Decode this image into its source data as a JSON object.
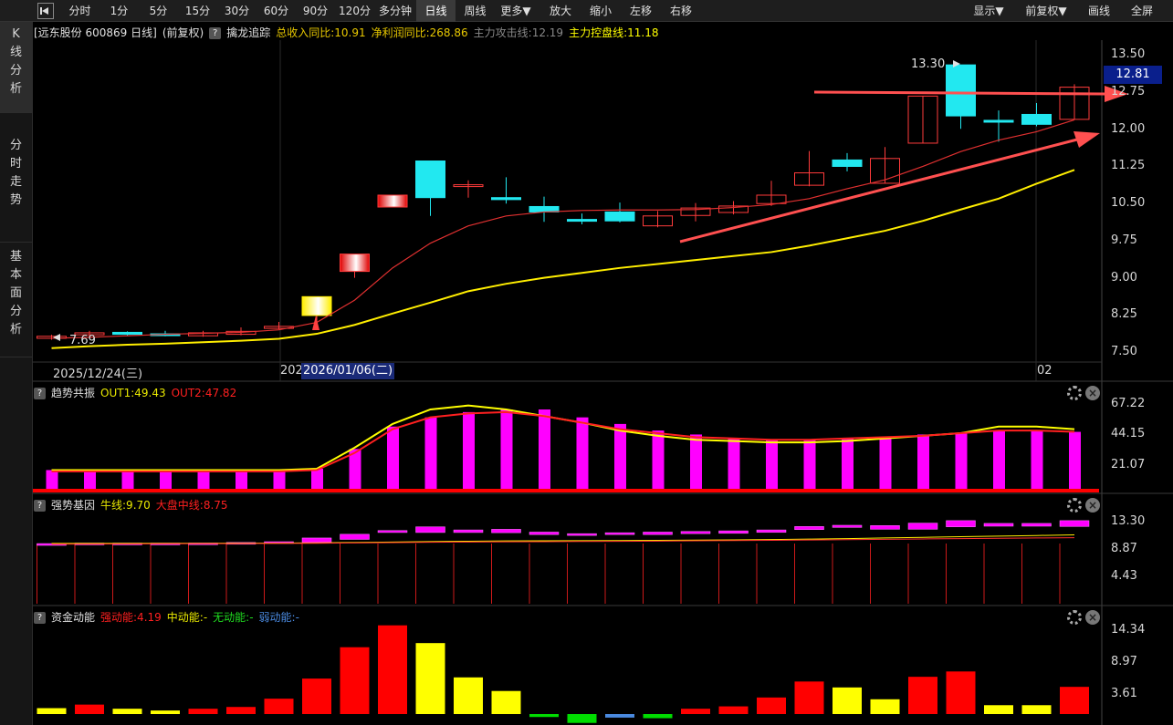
{
  "toolbar": {
    "periods": [
      "分时",
      "1分",
      "5分",
      "15分",
      "30分",
      "60分",
      "90分",
      "120分",
      "多分钟",
      "日线",
      "周线",
      "更多▼"
    ],
    "active_period": "日线",
    "actions": [
      "放大",
      "缩小",
      "左移",
      "右移"
    ],
    "right": [
      "显示▼",
      "前复权▼",
      "画线",
      "全屏"
    ]
  },
  "sidebar": {
    "tabs": [
      {
        "label": "K线分析",
        "active": true
      },
      {
        "label": "分时走势",
        "active": false
      },
      {
        "label": "基本面分析",
        "active": false
      }
    ]
  },
  "main_info": {
    "stock": "[远东股份 600869 日线]",
    "adjust": "(前复权)",
    "indicator": "擒龙追踪",
    "revenue_yoy": "总收入同比:10.91",
    "profit_yoy": "净利润同比:268.86",
    "attack_line": "主力攻击线:12.19",
    "control_line": "主力控盘线:11.18",
    "colors": {
      "revenue": "#e8c800",
      "profit": "#e8c800",
      "attack": "#888888",
      "control": "#ffff00"
    }
  },
  "price_axis": [
    "13.50",
    "12.75",
    "12.00",
    "11.25",
    "10.50",
    "9.75",
    "9.00",
    "8.25",
    "7.50"
  ],
  "current_price": "12.81",
  "high_label": "13.30",
  "low_label": "7.69",
  "dates": {
    "left": "2025/12/24(三)",
    "cursor_prefix": "202",
    "cursor": "2026/01/06(二)",
    "right": "02"
  },
  "panel1": {
    "title": "趋势共振",
    "out1": "OUT1:49.43",
    "out2": "OUT2:47.82",
    "axis": [
      "67.22",
      "44.15",
      "21.07"
    ]
  },
  "panel2": {
    "title": "强势基因",
    "bull": "牛线:9.70",
    "market": "大盘中线:8.75",
    "axis": [
      "13.30",
      "8.87",
      "4.43"
    ]
  },
  "panel3": {
    "title": "资金动能",
    "strong": "强动能:4.19",
    "mid": "中动能:-",
    "none": "无动能:-",
    "weak": "弱动能:-",
    "axis": [
      "14.34",
      "8.97",
      "3.61"
    ]
  },
  "chart_data": [
    {
      "type": "candlestick",
      "title": "远东股份 600869 日线",
      "ylim": [
        7.3,
        13.8
      ],
      "candles": [
        {
          "o": 7.78,
          "c": 7.82,
          "h": 7.85,
          "l": 7.75,
          "up": true
        },
        {
          "o": 7.85,
          "c": 7.89,
          "h": 7.93,
          "l": 7.82,
          "up": true
        },
        {
          "o": 7.9,
          "c": 7.86,
          "h": 7.92,
          "l": 7.83,
          "up": false
        },
        {
          "o": 7.87,
          "c": 7.86,
          "h": 7.93,
          "l": 7.82,
          "up": false
        },
        {
          "o": 7.83,
          "c": 7.89,
          "h": 7.93,
          "l": 7.81,
          "up": true
        },
        {
          "o": 7.86,
          "c": 7.92,
          "h": 8.0,
          "l": 7.84,
          "up": true
        },
        {
          "o": 7.98,
          "c": 8.02,
          "h": 8.11,
          "l": 7.96,
          "up": true
        },
        {
          "o": 8.24,
          "c": 8.62,
          "h": 8.62,
          "l": 8.1,
          "up": true,
          "special": "yellow"
        },
        {
          "o": 9.13,
          "c": 9.48,
          "h": 9.48,
          "l": 9.0,
          "up": true,
          "special": "red"
        },
        {
          "o": 10.43,
          "c": 10.67,
          "h": 10.67,
          "l": 10.43,
          "up": true,
          "special": "red"
        },
        {
          "o": 11.36,
          "c": 10.62,
          "h": 11.36,
          "l": 10.25,
          "up": false
        },
        {
          "o": 10.88,
          "c": 10.85,
          "h": 10.97,
          "l": 10.62,
          "up": true
        },
        {
          "o": 10.58,
          "c": 10.62,
          "h": 11.03,
          "l": 10.5,
          "up": false
        },
        {
          "o": 10.33,
          "c": 10.44,
          "h": 10.64,
          "l": 10.13,
          "up": false
        },
        {
          "o": 10.16,
          "c": 10.18,
          "h": 10.3,
          "l": 10.08,
          "up": false
        },
        {
          "o": 10.33,
          "c": 10.15,
          "h": 10.52,
          "l": 10.12,
          "up": false
        },
        {
          "o": 10.05,
          "c": 10.25,
          "h": 10.35,
          "l": 10.02,
          "up": true
        },
        {
          "o": 10.26,
          "c": 10.41,
          "h": 10.51,
          "l": 10.14,
          "up": true
        },
        {
          "o": 10.32,
          "c": 10.45,
          "h": 10.55,
          "l": 10.28,
          "up": true
        },
        {
          "o": 10.5,
          "c": 10.67,
          "h": 10.96,
          "l": 10.45,
          "up": true
        },
        {
          "o": 10.87,
          "c": 11.12,
          "h": 11.56,
          "l": 10.85,
          "up": true
        },
        {
          "o": 11.38,
          "c": 11.25,
          "h": 11.52,
          "l": 11.15,
          "up": false
        },
        {
          "o": 10.91,
          "c": 11.41,
          "h": 11.64,
          "l": 10.91,
          "up": true
        },
        {
          "o": 11.72,
          "c": 12.67,
          "h": 12.67,
          "l": 11.72,
          "up": true
        },
        {
          "o": 13.3,
          "c": 12.27,
          "h": 13.3,
          "l": 12.01,
          "up": false
        },
        {
          "o": 12.18,
          "c": 12.17,
          "h": 12.38,
          "l": 11.75,
          "up": false
        },
        {
          "o": 12.3,
          "c": 12.1,
          "h": 12.53,
          "l": 12.06,
          "up": false
        },
        {
          "o": 12.2,
          "c": 12.85,
          "h": 12.91,
          "l": 12.2,
          "up": true
        }
      ],
      "ma_red": [
        7.78,
        7.8,
        7.83,
        7.86,
        7.88,
        7.9,
        7.95,
        8.1,
        8.55,
        9.2,
        9.7,
        10.05,
        10.25,
        10.33,
        10.36,
        10.37,
        10.37,
        10.38,
        10.42,
        10.48,
        10.6,
        10.8,
        10.98,
        11.25,
        11.55,
        11.78,
        11.95,
        12.19
      ],
      "ma_yellow": [
        7.58,
        7.62,
        7.65,
        7.67,
        7.7,
        7.73,
        7.77,
        7.87,
        8.05,
        8.28,
        8.5,
        8.73,
        8.88,
        9.0,
        9.1,
        9.2,
        9.28,
        9.36,
        9.44,
        9.52,
        9.65,
        9.8,
        9.95,
        10.15,
        10.38,
        10.6,
        10.9,
        11.18
      ]
    },
    {
      "type": "bar",
      "title": "趋势共振",
      "ylim": [
        0,
        72
      ],
      "values": [
        17,
        17,
        17,
        17,
        17,
        17,
        17,
        18,
        33,
        50,
        57,
        61,
        63,
        63,
        57,
        52,
        47,
        44,
        41,
        40,
        40,
        41,
        42,
        44,
        45,
        47,
        47,
        46,
        44,
        47
      ],
      "out1": [
        17,
        17,
        17,
        17,
        17,
        17,
        17,
        18,
        34,
        52,
        63,
        66,
        63,
        58,
        53,
        47,
        43,
        40,
        39,
        38,
        38,
        39,
        41,
        43,
        45,
        50,
        50,
        48,
        45,
        49
      ],
      "out2": [
        16,
        16,
        16,
        16,
        16,
        16,
        16,
        17,
        30,
        48,
        57,
        60,
        61,
        58,
        53,
        48,
        45,
        42,
        41,
        40,
        40,
        41,
        42,
        43,
        45,
        47,
        47,
        46,
        44,
        48
      ]
    },
    {
      "type": "bar",
      "title": "强势基因",
      "ylim": [
        0,
        15
      ],
      "bars": [
        [
          9.63,
          9.7
        ],
        [
          9.7,
          9.78
        ],
        [
          9.72,
          9.78
        ],
        [
          9.74,
          9.78
        ],
        [
          9.74,
          9.8
        ],
        [
          9.76,
          9.88
        ],
        [
          9.8,
          10.0
        ],
        [
          9.86,
          10.6
        ],
        [
          10.37,
          11.2
        ],
        [
          11.48,
          11.8
        ],
        [
          11.48,
          12.4
        ],
        [
          11.48,
          11.9
        ],
        [
          11.45,
          12.0
        ],
        [
          11.15,
          11.55
        ],
        [
          11.16,
          11.3
        ],
        [
          11.15,
          11.45
        ],
        [
          11.15,
          11.55
        ],
        [
          11.3,
          11.65
        ],
        [
          11.35,
          11.75
        ],
        [
          11.5,
          11.9
        ],
        [
          11.95,
          12.45
        ],
        [
          12.3,
          12.65
        ],
        [
          12.0,
          12.6
        ],
        [
          12.0,
          13.0
        ],
        [
          12.4,
          13.4
        ],
        [
          12.5,
          12.95
        ],
        [
          12.5,
          12.95
        ],
        [
          12.45,
          13.4
        ]
      ],
      "bull_line": [
        9.72,
        9.72,
        9.73,
        9.74,
        9.75,
        9.76,
        9.78,
        9.82,
        9.88,
        9.95,
        10.02,
        10.08,
        10.12,
        10.15,
        10.17,
        10.19,
        10.22,
        10.25,
        10.3,
        10.35,
        10.42,
        10.5,
        10.6,
        10.7,
        10.8,
        10.9,
        11.0,
        11.1
      ],
      "market_line": [
        9.6,
        9.62,
        9.64,
        9.66,
        9.68,
        9.7,
        9.72,
        9.75,
        9.8,
        9.85,
        9.9,
        9.95,
        9.98,
        10.0,
        10.03,
        10.06,
        10.1,
        10.14,
        10.18,
        10.22,
        10.28,
        10.33,
        10.38,
        10.45,
        10.5,
        10.55,
        10.6,
        10.65
      ]
    },
    {
      "type": "bar",
      "title": "资金动能",
      "ylim": [
        -1.5,
        15.5
      ],
      "values": [
        1.0,
        1.6,
        0.9,
        0.6,
        0.9,
        1.2,
        2.6,
        6.0,
        11.3,
        15.0,
        12.0,
        6.2,
        3.9,
        -0.5,
        -1.5,
        -0.6,
        -0.7,
        0.9,
        1.3,
        2.8,
        5.5,
        4.5,
        2.5,
        6.3,
        7.2,
        1.5,
        1.5,
        4.6
      ],
      "kinds": [
        "y",
        "r",
        "y",
        "y",
        "r",
        "r",
        "r",
        "r",
        "r",
        "r",
        "y",
        "y",
        "y",
        "g",
        "g",
        "b",
        "g",
        "r",
        "r",
        "r",
        "r",
        "y",
        "y",
        "r",
        "r",
        "y",
        "y",
        "r"
      ]
    }
  ]
}
